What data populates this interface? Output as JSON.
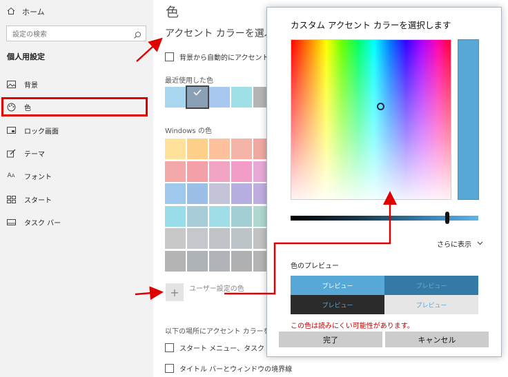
{
  "sidebar": {
    "home_label": "ホーム",
    "search_placeholder": "設定の検索",
    "section_title": "個人用設定",
    "items": [
      {
        "label": "背景",
        "icon": "image-icon"
      },
      {
        "label": "色",
        "icon": "palette-icon"
      },
      {
        "label": "ロック画面",
        "icon": "lock-screen-icon"
      },
      {
        "label": "テーマ",
        "icon": "theme-brush-icon"
      },
      {
        "label": "フォント",
        "icon": "font-icon"
      },
      {
        "label": "スタート",
        "icon": "start-icon"
      },
      {
        "label": "タスク バー",
        "icon": "taskbar-icon"
      }
    ]
  },
  "main": {
    "page_title": "色",
    "accent_heading": "アクセント カラーを選ぶ",
    "auto_accent_label": "背景から自動的にアクセント カ",
    "recent_colors_label": "最近使用した色",
    "recent_colors": [
      "#a8d6ee",
      "#8aa0b4",
      "#a8c8ef",
      "#9fe0e6",
      "#b5b5b5"
    ],
    "windows_colors_label": "Windows の色",
    "windows_colors": [
      [
        "#ffe199",
        "#ffd08a",
        "#ffc19c",
        "#f5b4a8",
        "#f0a8a0"
      ],
      [
        "#f3a9a9",
        "#f4a0a8",
        "#f2a4c4",
        "#f29cc8",
        "#e8a8d8"
      ],
      [
        "#9fc8ed",
        "#9bbfe6",
        "#c4c4d8",
        "#b6aee0",
        "#c0aee2"
      ],
      [
        "#99dde9",
        "#a8ccd8",
        "#a0dde6",
        "#a3ced3",
        "#b0d8d0"
      ],
      [
        "#c8c8c8",
        "#c4c8cc",
        "#c0c4c8",
        "#bcc4c8",
        "#c2c2c2"
      ],
      [
        "#b4b4b4",
        "#aeb3b8",
        "#b0b4b8",
        "#aeb0b2",
        "#b4b4b4"
      ]
    ],
    "custom_color_label": "ユーザー設定の色",
    "show_accent_label": "以下の場所にアクセント カラーを表示",
    "start_taskbar_label": "スタート メニュー、タスク バー、ア",
    "titlebar_label": "タイトル バーとウィンドウの境界線"
  },
  "dialog": {
    "title": "カスタム アクセント カラーを選択します",
    "selected_color": "#58a8d7",
    "more_label": "さらに表示",
    "preview_label": "色のプレビュー",
    "preview_text": "プレビュー",
    "warning": "この色は読みにくい可能性があります。",
    "done_label": "完了",
    "cancel_label": "キャンセル"
  }
}
